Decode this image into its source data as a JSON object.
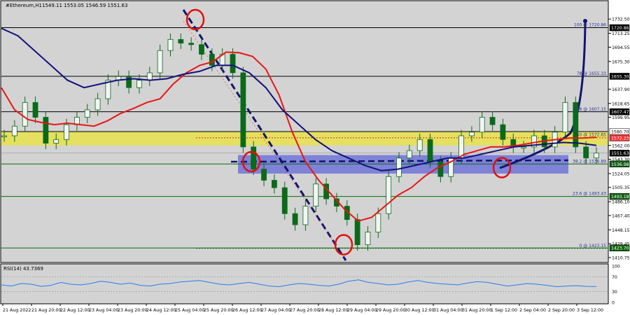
{
  "header": {
    "title": "#Ethereum,H1",
    "ohlc": "1549.11 1553.05 1546.59 1551.63"
  },
  "indicator": {
    "label": "RSI(14) 43.7369",
    "ticks": [
      "100",
      "70",
      "30",
      "0"
    ]
  },
  "price_axis": {
    "ticks": [
      "1732.50",
      "1713.25",
      "1694.55",
      "1675.30",
      "1637.90",
      "1618.65",
      "1599.95",
      "1562.00",
      "1543.30",
      "1524.05",
      "1505.35",
      "1486.10",
      "1467.40",
      "1448.15",
      "1429.45",
      "1410.75"
    ],
    "marks": [
      {
        "value": "1720.86",
        "color": "#000000",
        "text_color": "#ffffff"
      },
      {
        "value": "1655.30",
        "color": "#000000",
        "text_color": "#ffffff"
      },
      {
        "value": "1607.47",
        "color": "#000000",
        "text_color": "#ffffff"
      },
      {
        "value": "1580.70",
        "color": "#ffffff",
        "text_color": "#000000"
      },
      {
        "value": "1572.23",
        "color": "#ff3030",
        "text_color": "#ffffff"
      },
      {
        "value": "1551.63",
        "color": "#000000",
        "text_color": "#ffffff"
      },
      {
        "value": "1536.98",
        "color": "#106010",
        "text_color": "#ffffff"
      },
      {
        "value": "1493.18",
        "color": "#106010",
        "text_color": "#ffffff"
      },
      {
        "value": "1423.70",
        "color": "#106010",
        "text_color": "#ffffff"
      }
    ]
  },
  "time_axis": [
    "21 Aug 2022",
    "21 Aug 20:00",
    "22 Aug 12:00",
    "23 Aug 04:00",
    "23 Aug 20:00",
    "24 Aug 12:00",
    "25 Aug 04:00",
    "25 Aug 20:00",
    "26 Aug 12:00",
    "27 Aug 04:00",
    "27 Aug 20:00",
    "28 Aug 12:00",
    "29 Aug 04:00",
    "29 Aug 20:00",
    "30 Aug 12:00",
    "31 Aug 04:00",
    "31 Aug 20:00",
    "1 Sep 12:00",
    "2 Sep 04:00",
    "2 Sep 20:00",
    "3 Sep 12:00"
  ],
  "fib_labels": [
    {
      "text": "100 @ 1720.86",
      "value": 1720.86
    },
    {
      "text": "78 @ 1655.33",
      "value": 1655.33
    },
    {
      "text": "61.8 @ 1607.15",
      "value": 1607.15
    },
    {
      "text": "50 @ 1572.65",
      "value": 1572.65
    },
    {
      "text": "38.2 @ 1536.89",
      "value": 1536.89
    },
    {
      "text": "23.6 @ 1493.43",
      "value": 1493.43
    },
    {
      "text": "0 @ 1423.15",
      "value": 1423.15
    }
  ],
  "chart_data": {
    "type": "line",
    "title": "#Ethereum,H1",
    "y_range": [
      1405,
      1745
    ],
    "x_labels": [
      "21 Aug 2022",
      "21 Aug 20:00",
      "22 Aug 12:00",
      "23 Aug 04:00",
      "23 Aug 20:00",
      "24 Aug 12:00",
      "25 Aug 04:00",
      "25 Aug 20:00",
      "26 Aug 12:00",
      "27 Aug 04:00",
      "27 Aug 20:00",
      "28 Aug 12:00",
      "29 Aug 04:00",
      "29 Aug 20:00",
      "30 Aug 12:00",
      "31 Aug 04:00",
      "31 Aug 20:00",
      "1 Sep 12:00",
      "2 Sep 04:00",
      "2 Sep 20:00",
      "3 Sep 12:00"
    ],
    "price": [
      1575,
      1588,
      1620,
      1600,
      1565,
      1570,
      1590,
      1600,
      1610,
      1625,
      1650,
      1655,
      1640,
      1650,
      1660,
      1690,
      1705,
      1700,
      1698,
      1685,
      1670,
      1685,
      1660,
      1560,
      1530,
      1515,
      1505,
      1470,
      1455,
      1480,
      1510,
      1490,
      1480,
      1462,
      1428,
      1445,
      1470,
      1520,
      1545,
      1555,
      1570,
      1540,
      1520,
      1545,
      1575,
      1580,
      1600,
      1590,
      1570,
      1560,
      1560,
      1575,
      1560,
      1580,
      1620,
      1560,
      1545,
      1551.63
    ],
    "ma_red": [
      1640,
      1610,
      1597,
      1593,
      1590,
      1592,
      1590,
      1588,
      1595,
      1605,
      1612,
      1620,
      1625,
      1645,
      1660,
      1670,
      1675,
      1688,
      1687,
      1682,
      1665,
      1630,
      1580,
      1540,
      1515,
      1495,
      1475,
      1460,
      1465,
      1480,
      1495,
      1505,
      1520,
      1532,
      1540,
      1550,
      1555,
      1560,
      1560,
      1562,
      1565,
      1568,
      1570,
      1572,
      1572,
      1573
    ],
    "ma_blue": [
      1720,
      1710,
      1690,
      1670,
      1650,
      1640,
      1645,
      1650,
      1652,
      1650,
      1652,
      1658,
      1662,
      1670,
      1670,
      1660,
      1640,
      1610,
      1590,
      1570,
      1555,
      1545,
      1535,
      1528,
      1530,
      1535,
      1540,
      1545,
      1545,
      1550,
      1555,
      1560,
      1562,
      1564,
      1566,
      1565,
      1562
    ],
    "resistance_levels": [
      1720.86,
      1655.3,
      1607.47,
      1580.7
    ],
    "support_levels": [
      1536.98,
      1493.18,
      1423.7
    ],
    "red_dotted_level": 1572.23,
    "yellow_zone": [
      1562,
      1580.7
    ],
    "blue_zone": [
      1524,
      1549
    ],
    "annotations": [
      "circle @ 25 Aug 1710",
      "circle @ 26 Aug 1540",
      "circle @ 29 Aug 1428",
      "circle @ 1 Sep 1532"
    ],
    "rsi": {
      "value": 43.7369,
      "range": [
        0,
        100
      ],
      "levels": [
        70,
        30
      ],
      "series": [
        48,
        45,
        52,
        50,
        44,
        47,
        55,
        50,
        48,
        52,
        58,
        55,
        50,
        53,
        47,
        45,
        50,
        52,
        56,
        58,
        60,
        55,
        50,
        48,
        52,
        55,
        50,
        45,
        43,
        48,
        52,
        50,
        47,
        45,
        50,
        58,
        62,
        55,
        52,
        48,
        50,
        56,
        60,
        55,
        52,
        50,
        48,
        53,
        57,
        55,
        50,
        45,
        48,
        52,
        50,
        47,
        43,
        45,
        46,
        44,
        43.7369
      ]
    }
  }
}
